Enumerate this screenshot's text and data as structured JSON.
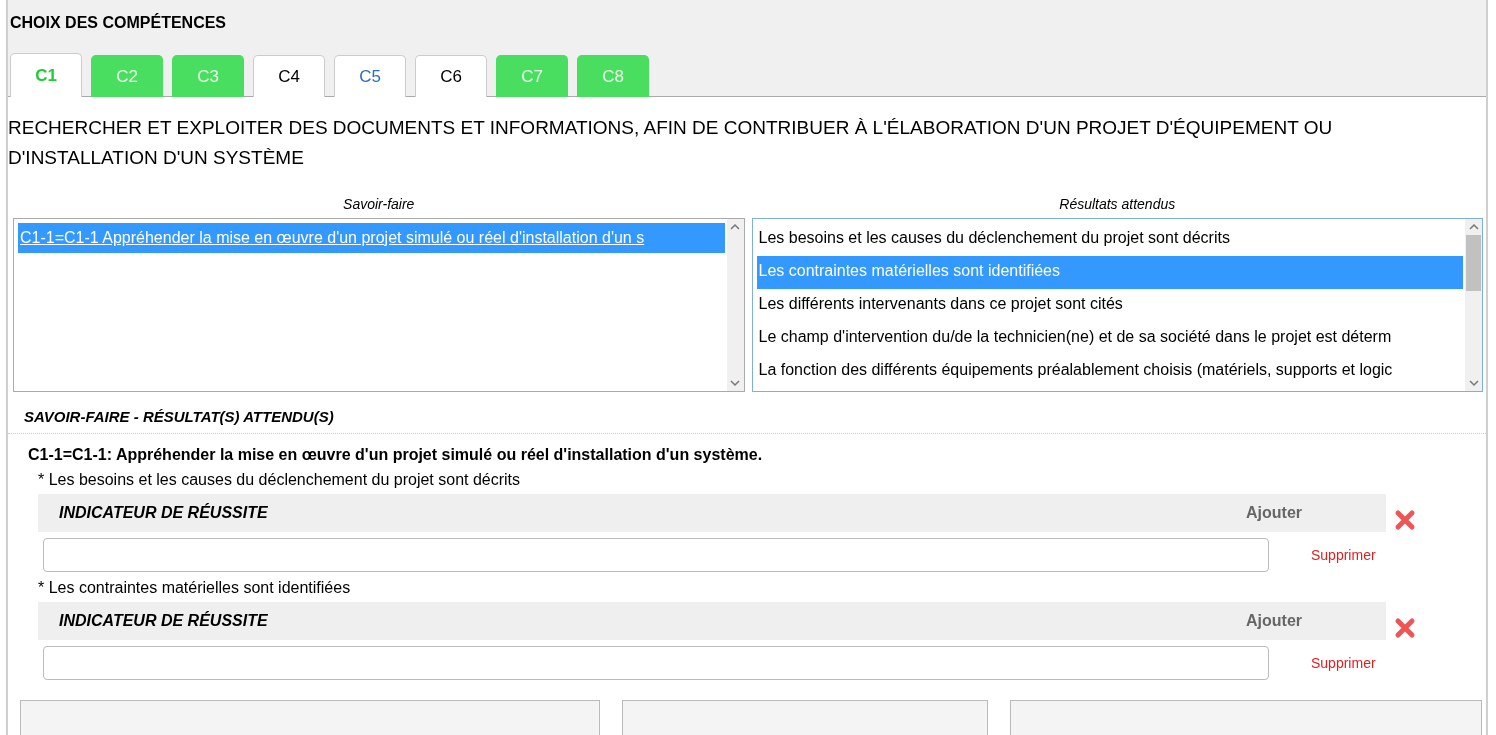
{
  "title": "CHOIX DES COMPÉTENCES",
  "tabs": [
    {
      "label": "C1",
      "selected": true,
      "kind": "complete"
    },
    {
      "label": "C2",
      "selected": false,
      "kind": "complete"
    },
    {
      "label": "C3",
      "selected": false,
      "kind": "complete"
    },
    {
      "label": "C4",
      "selected": false,
      "kind": "empty"
    },
    {
      "label": "C5",
      "selected": false,
      "kind": "partial"
    },
    {
      "label": "C6",
      "selected": false,
      "kind": "empty"
    },
    {
      "label": "C7",
      "selected": false,
      "kind": "complete"
    },
    {
      "label": "C8",
      "selected": false,
      "kind": "complete"
    }
  ],
  "competence_title": "RECHERCHER ET EXPLOITER DES DOCUMENTS ET INFORMATIONS, AFIN DE CONTRIBUER À L'ÉLABORATION D'UN PROJET D'ÉQUIPEMENT OU D'INSTALLATION D'UN SYSTÈME",
  "savoir_faire": {
    "label": "Savoir-faire",
    "items": [
      {
        "text": "C1-1=C1-1 Appréhender la mise en œuvre d'un projet simulé ou réel d'installation d'un s",
        "selected": true
      }
    ]
  },
  "resultats": {
    "label": "Résultats attendus",
    "items": [
      {
        "text": "Les besoins et les causes du déclenchement du projet sont décrits",
        "selected": false
      },
      {
        "text": "Les contraintes matérielles sont identifiées",
        "selected": true
      },
      {
        "text": "Les différents intervenants dans ce projet sont cités",
        "selected": false
      },
      {
        "text": "Le champ d'intervention du/de la technicien(ne) et de sa société dans le projet est déterm",
        "selected": false
      },
      {
        "text": "La fonction des différents équipements préalablement choisis (matériels, supports et logic",
        "selected": false
      }
    ]
  },
  "section_title": "SAVOIR-FAIRE - RÉSULTAT(S) ATTENDU(S)",
  "detail": {
    "heading": "C1-1=C1-1: Appréhender la mise en œuvre d'un projet simulé ou réel d'installation d'un système.",
    "results": [
      {
        "label": "* Les besoins et les causes du déclenchement du projet sont décrits",
        "indicator_header": "INDICATEUR DE RÉUSSITE",
        "add": "Ajouter",
        "delete": "Supprimer"
      },
      {
        "label": "* Les contraintes matérielles sont identifiées",
        "indicator_header": "INDICATEUR DE RÉUSSITE",
        "add": "Ajouter",
        "delete": "Supprimer"
      }
    ]
  }
}
